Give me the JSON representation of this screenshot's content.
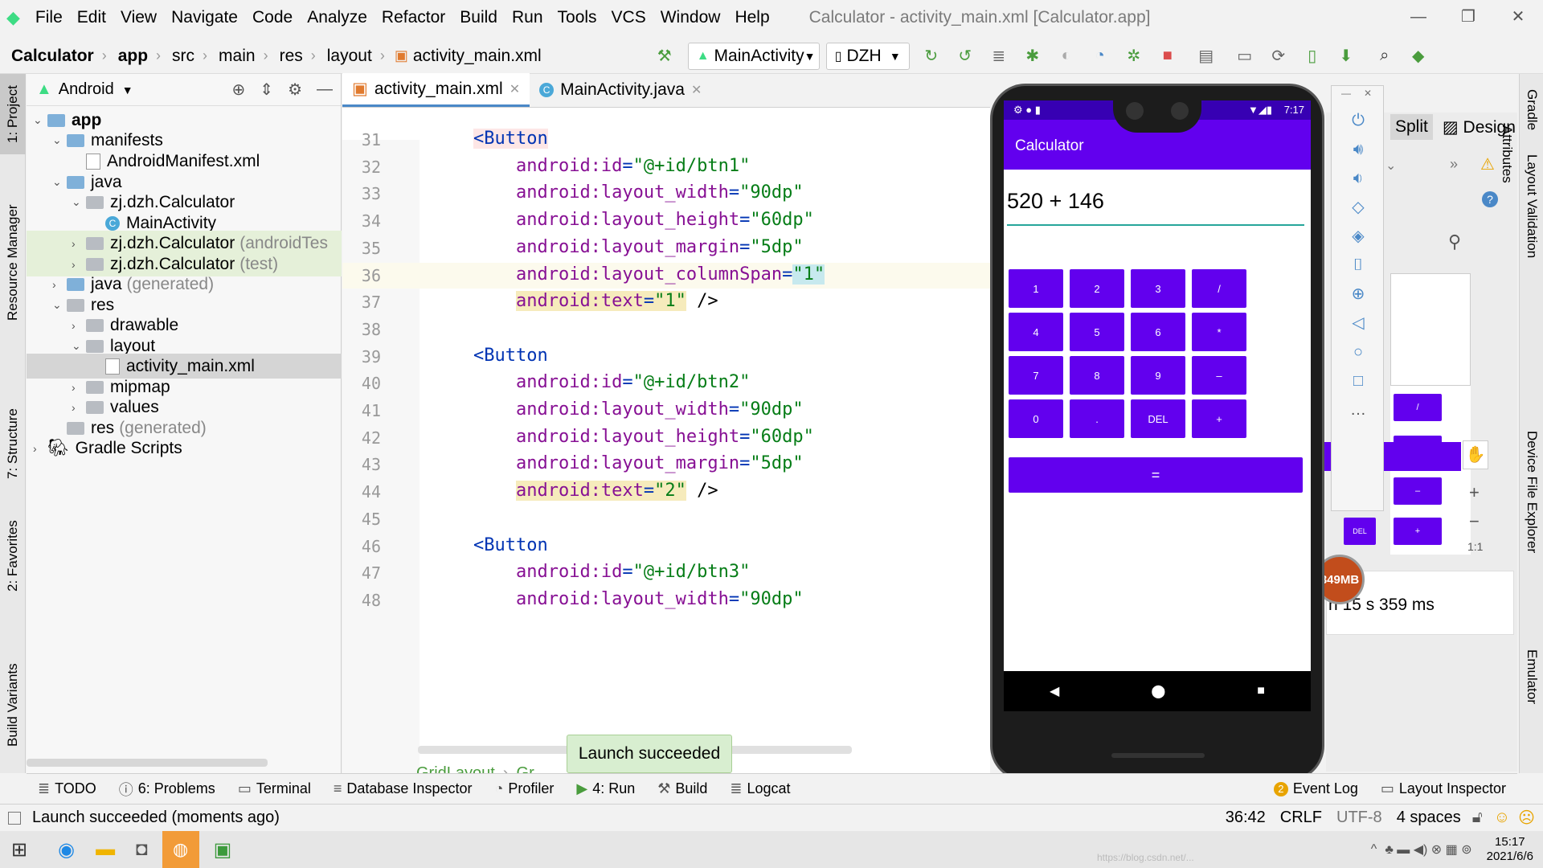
{
  "menubar": {
    "items": [
      "File",
      "Edit",
      "View",
      "Navigate",
      "Code",
      "Analyze",
      "Refactor",
      "Build",
      "Run",
      "Tools",
      "VCS",
      "Window",
      "Help"
    ],
    "window_title": "Calculator - activity_main.xml [Calculator.app]"
  },
  "navbar": {
    "crumbs": [
      "Calculator",
      "app",
      "src",
      "main",
      "res",
      "layout",
      "activity_main.xml"
    ],
    "run_config": "MainActivity",
    "device": "DZH"
  },
  "left_strip": [
    "1: Project",
    "Resource Manager",
    "7: Structure",
    "2: Favorites",
    "Build Variants"
  ],
  "right_strip": [
    "Gradle",
    "Layout Validation",
    "Device File Explorer",
    "Emulator"
  ],
  "project": {
    "view_label": "Android",
    "tree": [
      {
        "label": "app",
        "bold": true
      },
      {
        "label": "manifests"
      },
      {
        "label": "AndroidManifest.xml"
      },
      {
        "label": "java"
      },
      {
        "label": "zj.dzh.Calculator"
      },
      {
        "label": "MainActivity"
      },
      {
        "label": "zj.dzh.Calculator",
        "suffix": "(androidTes"
      },
      {
        "label": "zj.dzh.Calculator",
        "suffix": "(test)"
      },
      {
        "label": "java",
        "suffix": "(generated)"
      },
      {
        "label": "res"
      },
      {
        "label": "drawable"
      },
      {
        "label": "layout"
      },
      {
        "label": "activity_main.xml"
      },
      {
        "label": "mipmap"
      },
      {
        "label": "values"
      },
      {
        "label": "res",
        "suffix": "(generated)"
      },
      {
        "label": "Gradle Scripts"
      }
    ]
  },
  "editor": {
    "tabs": [
      "activity_main.xml",
      "MainActivity.java"
    ],
    "line_numbers": [
      "31",
      "32",
      "33",
      "34",
      "35",
      "36",
      "37",
      "38",
      "39",
      "40",
      "41",
      "42",
      "43",
      "44",
      "45",
      "46",
      "47",
      "48"
    ],
    "lines": [
      {
        "indent": "    ",
        "tag": "<Button"
      },
      {
        "indent": "        ",
        "attr": "android:id",
        "val": "\"@+id/btn1\""
      },
      {
        "indent": "        ",
        "attr": "android:layout_width",
        "val": "\"90dp\""
      },
      {
        "indent": "        ",
        "attr": "android:layout_height",
        "val": "\"60dp\""
      },
      {
        "indent": "        ",
        "attr": "android:layout_margin",
        "val": "\"5dp\""
      },
      {
        "indent": "        ",
        "attr": "android:layout_columnSpan",
        "val": "\"1\""
      },
      {
        "indent": "        ",
        "attr": "android:text",
        "val": "\"1\"",
        "end": " />"
      },
      {
        "indent": ""
      },
      {
        "indent": "    ",
        "tag": "<Button"
      },
      {
        "indent": "        ",
        "attr": "android:id",
        "val": "\"@+id/btn2\""
      },
      {
        "indent": "        ",
        "attr": "android:layout_width",
        "val": "\"90dp\""
      },
      {
        "indent": "        ",
        "attr": "android:layout_height",
        "val": "\"60dp\""
      },
      {
        "indent": "        ",
        "attr": "android:layout_margin",
        "val": "\"5dp\""
      },
      {
        "indent": "        ",
        "attr": "android:text",
        "val": "\"2\"",
        "end": " />"
      },
      {
        "indent": ""
      },
      {
        "indent": "    ",
        "tag": "<Button"
      },
      {
        "indent": "        ",
        "attr": "android:id",
        "val": "\"@+id/btn3\""
      },
      {
        "indent": "        ",
        "attr": "android:layout_width",
        "val": "\"90dp\""
      }
    ],
    "breadcrumb": "GridLayout",
    "breadcrumb2": "Gr"
  },
  "toast": "Launch succeeded",
  "design": {
    "split_label": "Split",
    "design_label": "Design",
    "attributes_label": "Attributes",
    "time_text": "h 15 s 359 ms",
    "memory": "349MB",
    "preview_buttons": [
      "/",
      "*",
      "–",
      "DEL",
      "+"
    ],
    "zoom_ratio": "1:1"
  },
  "phone": {
    "status_time": "7:17",
    "app_title": "Calculator",
    "display": "520 + 146",
    "buttons": [
      "1",
      "2",
      "3",
      "/",
      "4",
      "5",
      "6",
      "*",
      "7",
      "8",
      "9",
      "–",
      "0",
      ".",
      "DEL",
      "+"
    ],
    "equals": "=",
    "accent": "#6200ee"
  },
  "toolwindows": {
    "left": [
      "TODO",
      "6: Problems",
      "Terminal",
      "Database Inspector",
      "Profiler",
      "4: Run",
      "Build",
      "Logcat"
    ],
    "right": [
      "Event Log",
      "Layout Inspector"
    ],
    "event_count": "2"
  },
  "status": {
    "message": "Launch succeeded (moments ago)",
    "position": "36:42",
    "line_sep": "CRLF",
    "encoding": "UTF-8",
    "indent": "4 spaces"
  },
  "taskbar": {
    "time": "15:17",
    "date": "2021/6/6",
    "watermark": "https://blog.csdn.net/..."
  }
}
